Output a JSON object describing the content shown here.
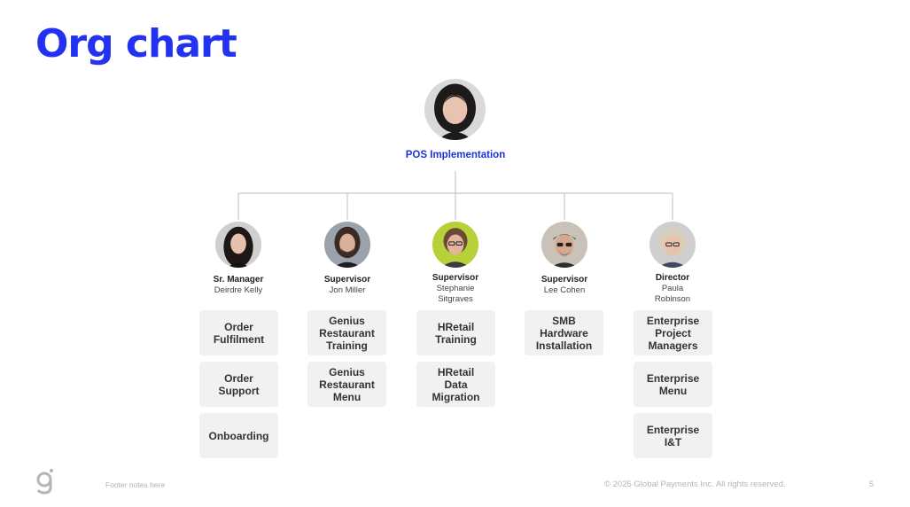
{
  "title": "Org chart",
  "root": {
    "label": "POS Implementation"
  },
  "members": [
    {
      "role": "Sr. Manager",
      "name": "Deirdre Kelly",
      "teams": [
        "Order\nFulfilment",
        "Order\nSupport",
        "Onboarding"
      ]
    },
    {
      "role": "Supervisor",
      "name": "Jon Miller",
      "teams": [
        "Genius\nRestaurant\nTraining",
        "Genius\nRestaurant\nMenu"
      ]
    },
    {
      "role": "Supervisor",
      "name": "Stephanie\nSitgraves",
      "teams": [
        "HRetail\nTraining",
        "HRetail\nData\nMigration"
      ]
    },
    {
      "role": "Supervisor",
      "name": "Lee Cohen",
      "teams": [
        "SMB\nHardware\nInstallation"
      ]
    },
    {
      "role": "Director",
      "name": "Paula\nRobinson",
      "teams": [
        "Enterprise\nProject\nManagers",
        "Enterprise\nMenu",
        "Enterprise\nI&T"
      ]
    }
  ],
  "footer": {
    "notes": "Footer notes here",
    "copyright": "© 2025 Global Payments Inc. All rights reserved.",
    "page": "5"
  },
  "colors": {
    "accent": "#2332f0",
    "box_bg": "#f1f1f1",
    "connector": "#c8c8c8"
  }
}
